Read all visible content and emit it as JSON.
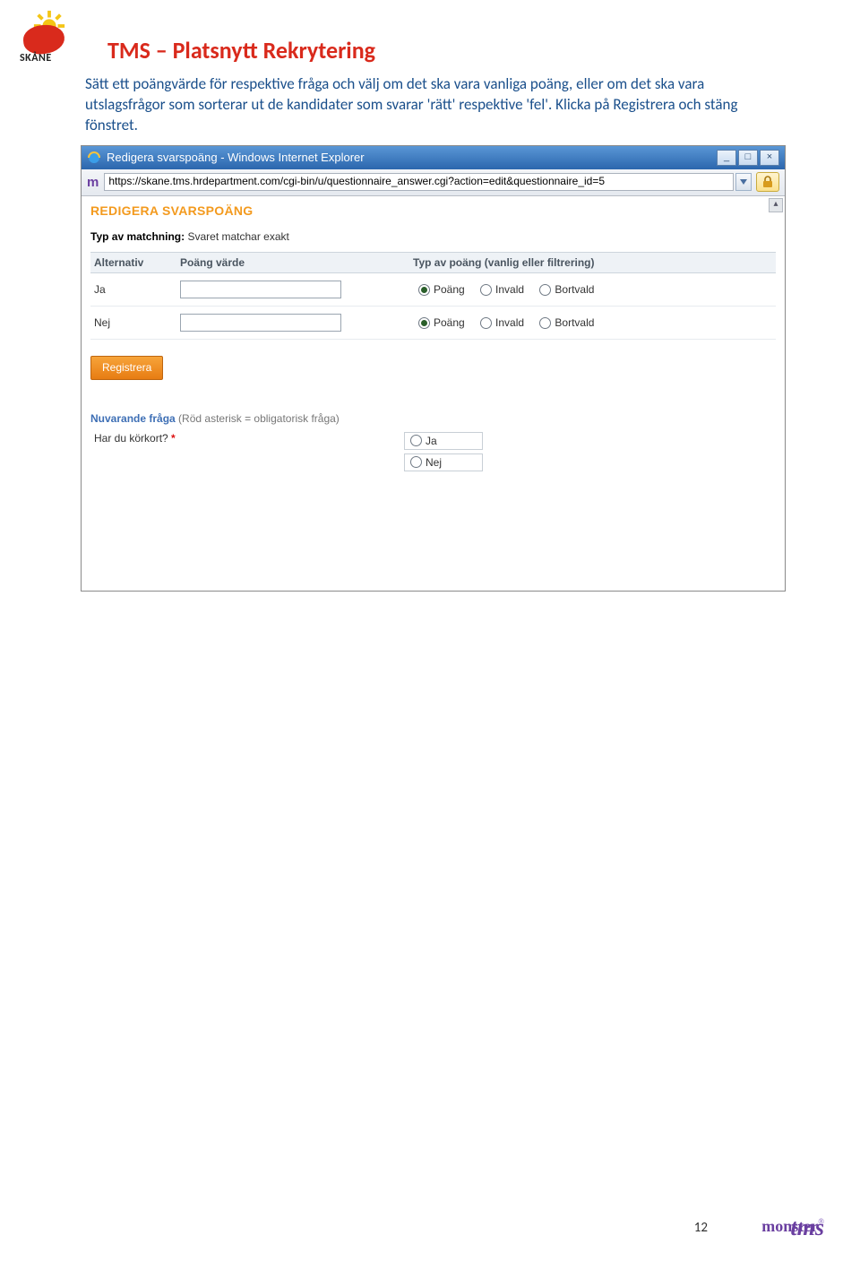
{
  "header": {
    "region_logo_text": "SKÅNE",
    "doc_title": "TMS – Platsnytt Rekrytering"
  },
  "body_paragraph": "Sätt ett poängvärde för respektive fråga och välj om det ska vara vanliga poäng, eller om det ska vara utslagsfrågor som sorterar ut de kandidater som svarar 'rätt' respektive 'fel'. Klicka på Registrera och stäng fönstret.",
  "browser": {
    "title": "Redigera svarspoäng - Windows Internet Explorer",
    "url": "https://skane.tms.hrdepartment.com/cgi-bin/u/questionnaire_answer.cgi?action=edit&questionnaire_id=5",
    "win_min": "_",
    "win_max": "□",
    "win_close": "×"
  },
  "form": {
    "page_title": "REDIGERA SVARSPOÄNG",
    "match_label": "Typ av matchning:",
    "match_value": "Svaret matchar exakt",
    "columns": {
      "alt": "Alternativ",
      "val": "Poäng värde",
      "typ": "Typ av poäng (vanlig eller filtrering)"
    },
    "radios": {
      "poang": "Poäng",
      "invald": "Invald",
      "bortvald": "Bortvald"
    },
    "rows": [
      {
        "alt": "Ja",
        "value": "",
        "selected": "poang"
      },
      {
        "alt": "Nej",
        "value": "",
        "selected": "poang"
      }
    ],
    "register_btn": "Registrera",
    "current_q_heading": "Nuvarande fråga",
    "current_q_note": "(Röd asterisk = obligatorisk fråga)",
    "question_text": "Har du körkort?",
    "question_required": "*",
    "question_options": [
      "Ja",
      "Nej"
    ]
  },
  "footer": {
    "page_number": "12",
    "brand1": "monster",
    "brand1_reg": "®",
    "brand2": "tms"
  }
}
